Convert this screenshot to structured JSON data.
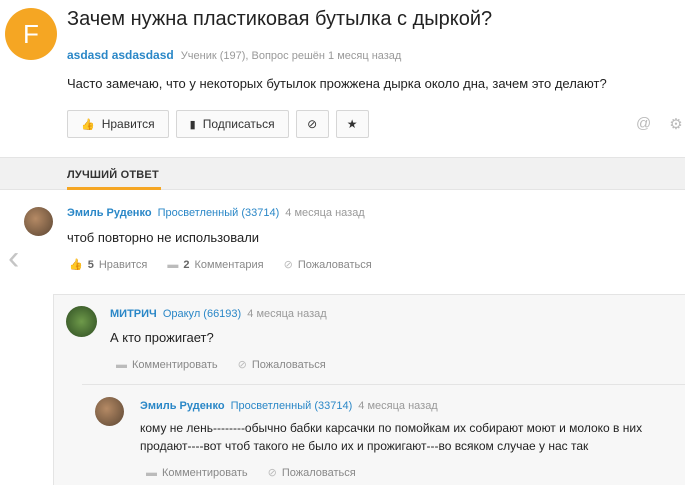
{
  "question": {
    "avatar_letter": "F",
    "title": "Зачем нужна пластиковая бутылка с дыркой?",
    "author": "asdasd asdasdasd",
    "meta": "Ученик (197), Вопрос решён 1 месяц назад",
    "body": "Часто замечаю, что у некоторых бутылок прожжена дырка около дна, зачем это делают?",
    "buttons": {
      "like_label": "Нравится",
      "subscribe_label": "Подписаться"
    }
  },
  "best_answer": {
    "section_label": "ЛУЧШИЙ ОТВЕТ",
    "author": "Эмиль Руденко",
    "rank": "Просветленный (33714)",
    "time": "4 месяца назад",
    "text": "чтоб повторно не использовали",
    "likes_count": "5",
    "likes_label": "Нравится",
    "comments_count": "2",
    "comments_label": "Комментария",
    "report_label": "Пожаловаться"
  },
  "comments": [
    {
      "author": "МИТРИЧ",
      "rank": "Оракул (66193)",
      "time": "4 месяца назад",
      "text": "А кто прожигает?",
      "comment_label": "Комментировать",
      "report_label": "Пожаловаться"
    },
    {
      "author": "Эмиль Руденко",
      "rank": "Просветленный (33714)",
      "time": "4 месяца назад",
      "text_line1": "кому не лень--------обычно бабки карсачки по помойкам их собирают моют и молоко в них",
      "text_line2": "продают----вот чтоб такого не было их и прожигают---во всяком случае у нас так",
      "comment_label": "Комментировать",
      "report_label": "Пожаловаться"
    }
  ],
  "icons": {
    "like": "thumbs-up-icon",
    "bookmark": "bookmark-icon",
    "block": "block-icon",
    "star": "star-icon",
    "mention": "at-icon",
    "settings": "gear-icon",
    "comment": "comment-icon",
    "report": "report-icon",
    "prev": "chevron-left-icon"
  },
  "colors": {
    "accent": "#f5a623",
    "link": "#2a87c7"
  }
}
